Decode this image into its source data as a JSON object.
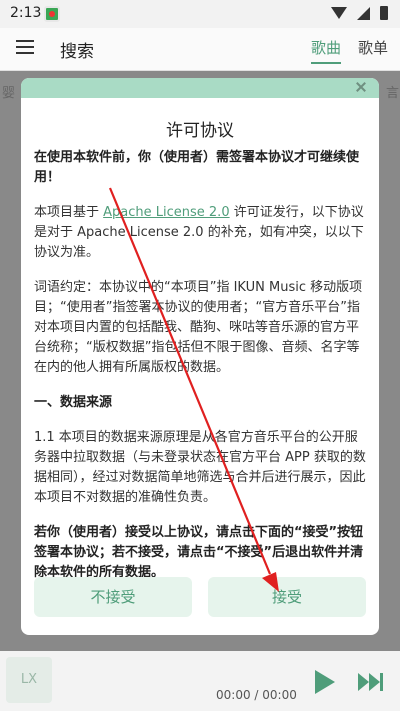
{
  "status_bar": {
    "time": "2:13"
  },
  "header": {
    "title": "搜索",
    "tab_song": "歌曲",
    "tab_list": "歌单"
  },
  "background": {
    "left_edge_char": "婴",
    "right_edge_char": "言"
  },
  "dialog": {
    "title": "许可协议",
    "intro_bold": "在使用本软件前，你（使用者）需签署本协议才可继续使用！",
    "para1_pre": "本项目基于 ",
    "para1_link": "Apache License 2.0",
    "para1_post": " 许可证发行，以下协议是对于 Apache License 2.0 的补充，如有冲突，以以下协议为准。",
    "para2": "词语约定：本协议中的“本项目”指 IKUN Music 移动版项目；“使用者”指签署本协议的使用者；“官方音乐平台”指对本项目内置的包括酷我、酷狗、咪咕等音乐源的官方平台统称；“版权数据”指包括但不限于图像、音频、名字等在内的他人拥有所属版权的数据。",
    "section1_title": "一、数据来源",
    "para3": "1.1 本项目的数据来源原理是从各官方音乐平台的公开服务器中拉取数据（与未登录状态在官方平台 APP 获取的数据相同），经过对数据简单地筛选与合并后进行展示，因此本项目不对数据的准确性负责。",
    "final_bold": "若你（使用者）接受以上协议，请点击下面的“接受”按钮签署本协议；若不接受，请点击“不接受”后退出软件并清除本软件的所有数据。",
    "decline_label": "不接受",
    "accept_label": "接受"
  },
  "player": {
    "cover_text": "LX",
    "time": "00:00 / 00:00"
  },
  "colors": {
    "accent": "#4f9d7a",
    "annotation": "#e02020"
  },
  "icons": [
    "menu-icon",
    "close-icon",
    "play-icon",
    "next-icon",
    "wifi-icon",
    "signal-icon",
    "battery-icon"
  ]
}
